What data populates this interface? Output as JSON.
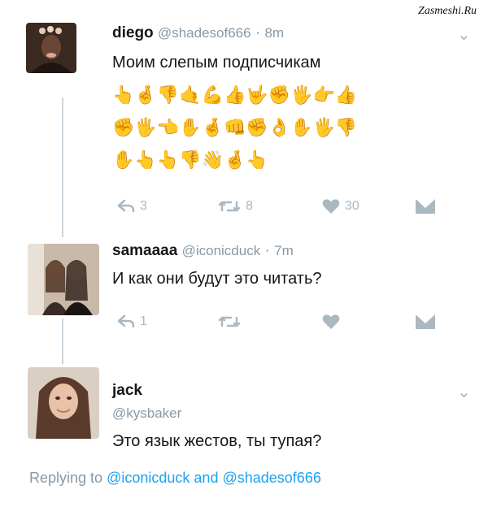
{
  "watermark": "Zasmeshi.Ru",
  "tweets": [
    {
      "name": "diego",
      "handle": "@shadesof666",
      "time": "8m",
      "text": "Моим слепым подписчикам",
      "emoji_rows": [
        "👆🤞👎🤙💪👍🤟✊🖐👉👍",
        "✊🖐👈✋🤞👊✊👌✋🖐👎",
        "✋👆👆👎👋🤞👆"
      ],
      "reply_count": "3",
      "retweet_count": "8",
      "like_count": "30"
    },
    {
      "name": "samaaaa",
      "handle": "@iconicduck",
      "time": "7m",
      "text": "И как они будут это читать?",
      "reply_count": "1"
    },
    {
      "name": "jack",
      "handle": "@kysbaker",
      "text": "Это язык жестов, ты тупая?"
    }
  ],
  "replying": {
    "prefix": "Replying to",
    "user1": "@iconicduck",
    "and": "and",
    "user2": "@shadesof666"
  },
  "colors": {
    "muted": "#8899a6",
    "icon": "#aab8c2",
    "link": "#1da1f2",
    "thread": "#ccd6dd"
  }
}
